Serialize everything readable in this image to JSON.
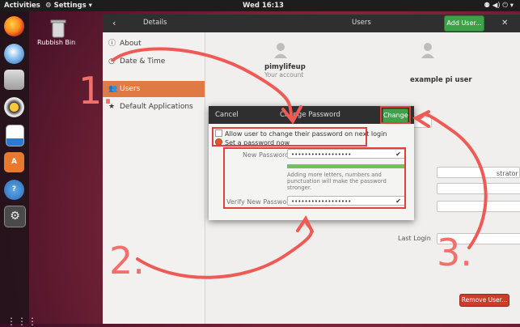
{
  "topbar": {
    "activities": "Activities",
    "app_menu": "⚙ Settings ▾",
    "clock": "Wed 16:13",
    "tray": "⚉ ◀) ⏻ ▾"
  },
  "desktop": {
    "trash_label": "Rubbish Bin"
  },
  "header": {
    "back": "‹",
    "details": "Details",
    "users": "Users",
    "add_user": "Add User...",
    "close": "✕"
  },
  "sidebar": {
    "items": [
      {
        "icon": "ⓘ",
        "label": "About"
      },
      {
        "icon": "◷",
        "label": "Date & Time"
      },
      {
        "icon": "👥",
        "label": "Users"
      },
      {
        "icon": "★",
        "label": "Default Applications"
      }
    ]
  },
  "users": [
    {
      "name": "pimylifeup",
      "sub": "Your account"
    },
    {
      "name": "example pi user",
      "sub": ""
    }
  ],
  "background": {
    "admin_text": "strator",
    "last_login": "Last Login"
  },
  "remove_user": "Remove User...",
  "dialog": {
    "cancel": "Cancel",
    "title": "Change Password",
    "change": "Change",
    "option_allow": "Allow user to change their password on next login",
    "option_set": "Set a password now",
    "new_password_label": "New Password",
    "new_password_value": "••••••••••••••••••",
    "verify_label": "Verify New Password",
    "verify_value": "••••••••••••••••••",
    "strength": 1.0,
    "hint": "Adding more letters, numbers and punctuation will make the password stronger."
  },
  "annotations": {
    "step1": "1.",
    "step2": "2.",
    "step3": "3."
  },
  "colors": {
    "accent": "#e07a45",
    "annotation": "#e0413a",
    "confirm": "#3fa04a",
    "danger": "#cc3b2b"
  }
}
